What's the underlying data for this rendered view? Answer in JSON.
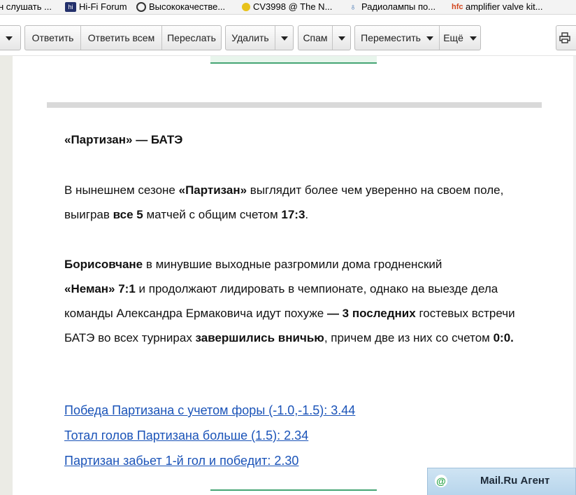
{
  "bookmarks": [
    {
      "label": "н слушать ...",
      "icon": "page-icon"
    },
    {
      "label": "Hi-Fi Forum",
      "icon": "hifi-icon"
    },
    {
      "label": "Высококачестве...",
      "icon": "eye-icon"
    },
    {
      "label": "CV3998 @ The N...",
      "icon": "sun-icon"
    },
    {
      "label": "Радиолампы по...",
      "icon": "tube-icon"
    },
    {
      "label": "amplifier valve kit...",
      "icon": "hfc-icon"
    }
  ],
  "toolbar": {
    "reply": "Ответить",
    "reply_all": "Ответить всем",
    "forward": "Переслать",
    "delete": "Удалить",
    "spam": "Спам",
    "move": "Переместить",
    "more": "Ещё"
  },
  "article": {
    "heading": "«Партизан» — БАТЭ",
    "p1": {
      "a": "В нынешнем сезоне ",
      "b1": "«Партизан»",
      "c": " выглядит более чем уверенно на своем поле, выиграв ",
      "b2": "все 5",
      "d": " матчей с общим счетом ",
      "b3": "17:3",
      "e": "."
    },
    "p2": {
      "b1": "Борисовчане",
      "a": " в минувшие выходные разгромили дома гродненский ",
      "b2": "«Неман» 7:1",
      "c": " и продолжают лидировать в чемпионате, однако на выезде дела команды Александра Ермаковича идут похуже ",
      "b3": "— 3 последних",
      "d": " гостевых встречи БАТЭ во всех турнирах ",
      "b4": "завершились вничью",
      "e": ", причем две из них со счетом ",
      "b5": "0:0."
    },
    "links": [
      "Победа Партизана с учетом форы (-1.0,-1.5): 3.44",
      "Тотал голов Партизана больше (1.5): 2.34",
      "Партизан забьет 1-й гол и победит: 2.30"
    ]
  },
  "agent": {
    "label": "Mail.Ru Агент",
    "icon": "at-icon"
  },
  "colors": {
    "link": "#1a53b8",
    "accent_green": "#45a574",
    "agent_bg": "#c4ddf0"
  }
}
